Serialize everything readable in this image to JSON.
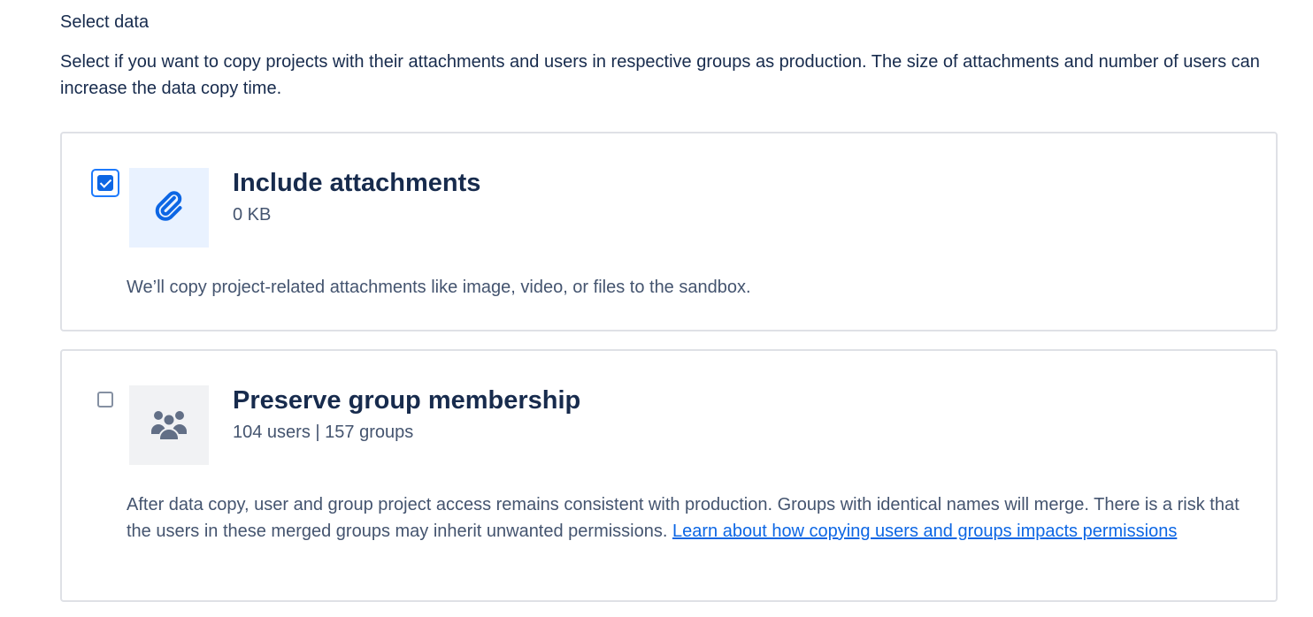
{
  "section": {
    "title": "Select data",
    "description": "Select if you want to copy projects with their attachments and users in respective groups as production. The size of attachments and number of users can increase the data copy time."
  },
  "options": [
    {
      "title": "Include attachments",
      "meta": "0 KB",
      "checked": true,
      "icon": "paperclip-icon",
      "description": "We’ll copy project-related attachments like image, video, or files to the sandbox."
    },
    {
      "title": "Preserve group membership",
      "meta": "104 users | 157 groups",
      "checked": false,
      "icon": "people-group-icon",
      "description": "After data copy, user and group project access remains consistent with production. Groups with identical names will merge. There is a risk that the users in these merged groups may inherit unwanted permissions.",
      "link_text": "Learn about how copying users and groups impacts permissions"
    }
  ],
  "colors": {
    "accent": "#0c66e4",
    "text": "#172b4d",
    "subtle_text": "#44546f",
    "border": "#dfe1e6"
  }
}
